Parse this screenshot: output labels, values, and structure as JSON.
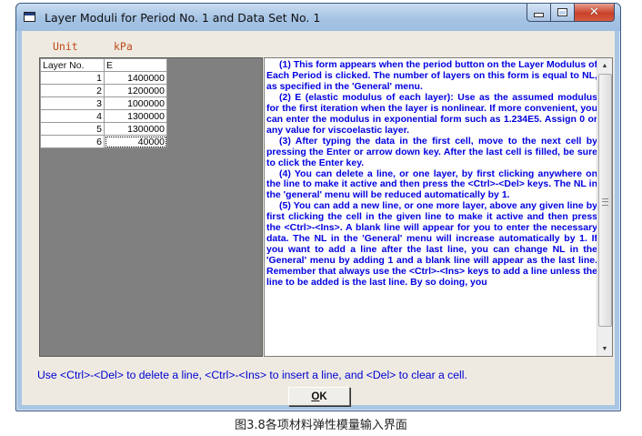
{
  "window": {
    "title": "Layer Moduli for Period No. 1 and Data Set No. 1"
  },
  "unit": {
    "label": "Unit",
    "value": "kPa"
  },
  "grid": {
    "headers": [
      "Layer No.",
      "E"
    ],
    "rows": [
      {
        "no": "1",
        "e": "1400000"
      },
      {
        "no": "2",
        "e": "1200000"
      },
      {
        "no": "3",
        "e": "1000000"
      },
      {
        "no": "4",
        "e": "1300000"
      },
      {
        "no": "5",
        "e": "1300000"
      },
      {
        "no": "6",
        "e": "40000"
      }
    ]
  },
  "help": {
    "paragraphs": [
      "(1)  This form appears when the period button on the Layer Modulus of Each Period is clicked.  The number of layers on this form is equal to NL, as specified in the 'General' menu.",
      "(2)  E (elastic modulus of each layer): Use as the assumed modulus for the first iteration when the layer is nonlinear.  If more convenient, you can enter the modulus in exponential form such as 1.234E5.  Assign 0 or any value for viscoelastic layer.",
      "(3)  After typing the data in the first cell, move to the next cell by pressing the Enter or arrow down key.  After the last cell is filled, be sure to click the Enter key.",
      "(4)  You can delete a line, or one layer, by first clicking anywhere on the line to make it active and then press the <Ctrl>-<Del> keys.  The NL in the 'general' menu will be reduced automatically by 1.",
      "(5) You can add a new line, or one more layer, above any given line by first clicking the cell in the given line to make it active and then press the <Ctrl>-<Ins>.  A blank line will appear for you to enter the necessary data.  The NL in the 'General' menu will increase automatically by 1.  If you want to add a line after the last line, you can change NL in the 'General' menu by adding 1 and a blank line will appear as the last line.  Remember that always use the <Ctrl>-<Ins> keys to add a line unless the line to be added is the last line.  By so doing, you"
    ]
  },
  "status_text": "Use <Ctrl>-<Del> to delete a line, <Ctrl>-<Ins> to insert a line, and <Del> to clear a cell.",
  "ok_button": {
    "accel": "O",
    "rest": "K"
  },
  "figure_caption": "图3.8各项材料弹性模量输入界面",
  "icons": {
    "app": "app-window-icon",
    "minimize": "minimize-icon",
    "maximize": "maximize-icon",
    "close": "close-icon"
  }
}
